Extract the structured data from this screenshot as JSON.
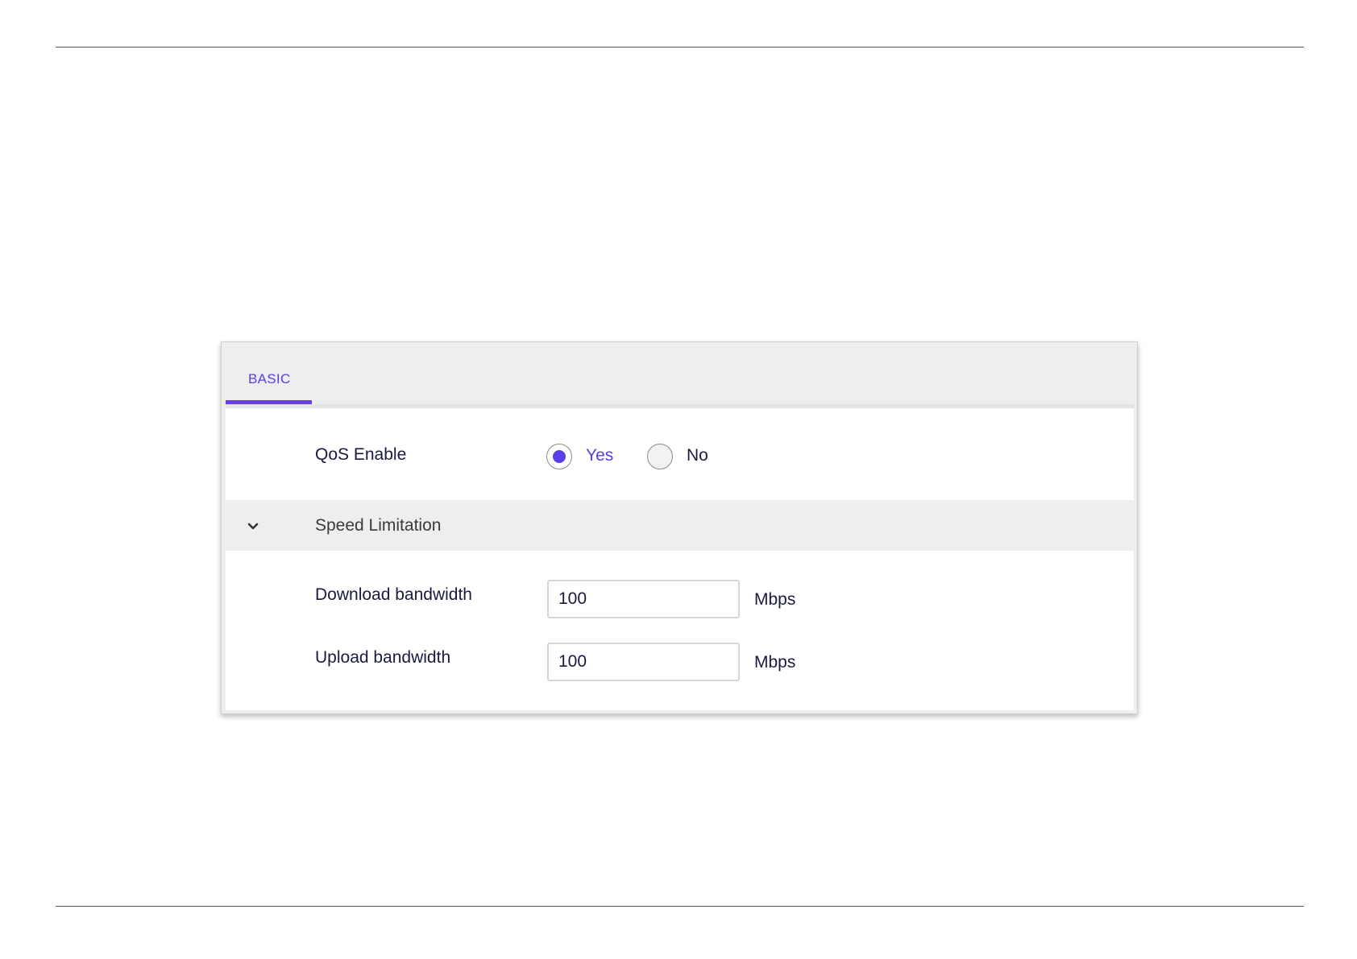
{
  "tabs": [
    {
      "label": "BASIC",
      "active": true
    }
  ],
  "qos": {
    "label": "QoS Enable",
    "options": [
      {
        "label": "Yes",
        "checked": true
      },
      {
        "label": "No",
        "checked": false
      }
    ]
  },
  "speed_limitation": {
    "title": "Speed Limitation",
    "expanded": true,
    "icon": "chevron-down-icon",
    "download": {
      "label": "Download bandwidth",
      "value": "100",
      "unit": "Mbps"
    },
    "upload": {
      "label": "Upload bandwidth",
      "value": "100",
      "unit": "Mbps"
    }
  },
  "colors": {
    "accent": "#5b3ee6",
    "text": "#1a1a40",
    "panel_bg": "#eeeeee"
  }
}
